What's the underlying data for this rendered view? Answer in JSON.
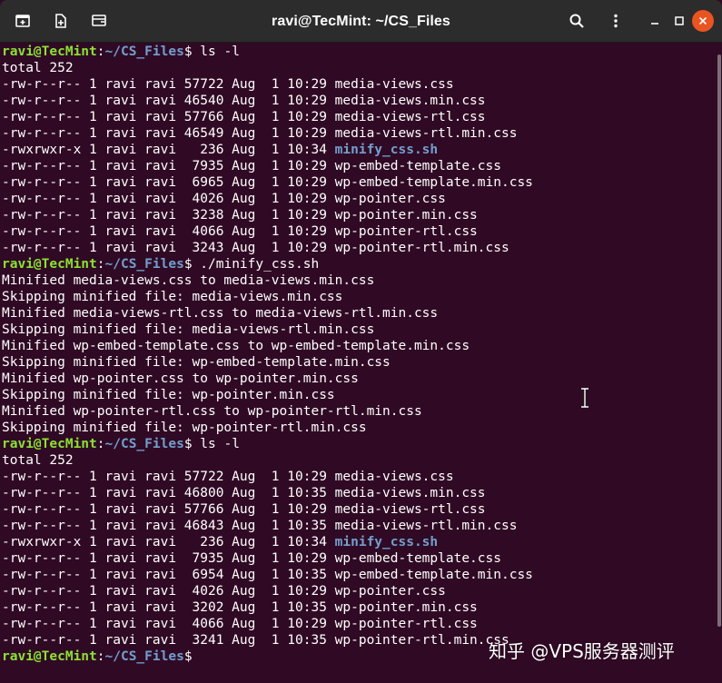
{
  "window": {
    "title": "ravi@TecMint: ~/CS_Files"
  },
  "icons": {
    "new_tab": "new-tab-icon",
    "new_window": "new-window-icon",
    "split": "split-terminal-icon",
    "search": "search-icon",
    "menu": "kebab-menu-icon",
    "minimize": "minimize-icon",
    "maximize": "maximize-icon",
    "close": "close-icon"
  },
  "colors": {
    "background": "#300a24",
    "prompt_user": "#8ae234",
    "prompt_path": "#729fcf",
    "executable": "#729fcf",
    "close_button": "#e95420",
    "titlebar": "#2c2c2c"
  },
  "prompt": {
    "user_host": "ravi@TecMint",
    "separator": ":",
    "path": "~/CS_Files",
    "symbol": "$"
  },
  "watermark": "知乎 @VPS服务器测评",
  "lines": [
    {
      "kind": "prompt",
      "cmd": " ls -l"
    },
    {
      "kind": "text",
      "text": "total 252"
    },
    {
      "kind": "ls",
      "perm": "-rw-r--r-- 1 ravi ravi 57722 Aug  1 10:29 ",
      "file": "media-views.css",
      "exec": false
    },
    {
      "kind": "ls",
      "perm": "-rw-r--r-- 1 ravi ravi 46540 Aug  1 10:29 ",
      "file": "media-views.min.css",
      "exec": false
    },
    {
      "kind": "ls",
      "perm": "-rw-r--r-- 1 ravi ravi 57766 Aug  1 10:29 ",
      "file": "media-views-rtl.css",
      "exec": false
    },
    {
      "kind": "ls",
      "perm": "-rw-r--r-- 1 ravi ravi 46549 Aug  1 10:29 ",
      "file": "media-views-rtl.min.css",
      "exec": false
    },
    {
      "kind": "ls",
      "perm": "-rwxrwxr-x 1 ravi ravi   236 Aug  1 10:34 ",
      "file": "minify_css.sh",
      "exec": true
    },
    {
      "kind": "ls",
      "perm": "-rw-r--r-- 1 ravi ravi  7935 Aug  1 10:29 ",
      "file": "wp-embed-template.css",
      "exec": false
    },
    {
      "kind": "ls",
      "perm": "-rw-r--r-- 1 ravi ravi  6965 Aug  1 10:29 ",
      "file": "wp-embed-template.min.css",
      "exec": false
    },
    {
      "kind": "ls",
      "perm": "-rw-r--r-- 1 ravi ravi  4026 Aug  1 10:29 ",
      "file": "wp-pointer.css",
      "exec": false
    },
    {
      "kind": "ls",
      "perm": "-rw-r--r-- 1 ravi ravi  3238 Aug  1 10:29 ",
      "file": "wp-pointer.min.css",
      "exec": false
    },
    {
      "kind": "ls",
      "perm": "-rw-r--r-- 1 ravi ravi  4066 Aug  1 10:29 ",
      "file": "wp-pointer-rtl.css",
      "exec": false
    },
    {
      "kind": "ls",
      "perm": "-rw-r--r-- 1 ravi ravi  3243 Aug  1 10:29 ",
      "file": "wp-pointer-rtl.min.css",
      "exec": false
    },
    {
      "kind": "prompt",
      "cmd": " ./minify_css.sh"
    },
    {
      "kind": "text",
      "text": "Minified media-views.css to media-views.min.css"
    },
    {
      "kind": "text",
      "text": "Skipping minified file: media-views.min.css"
    },
    {
      "kind": "text",
      "text": "Minified media-views-rtl.css to media-views-rtl.min.css"
    },
    {
      "kind": "text",
      "text": "Skipping minified file: media-views-rtl.min.css"
    },
    {
      "kind": "text",
      "text": "Minified wp-embed-template.css to wp-embed-template.min.css"
    },
    {
      "kind": "text",
      "text": "Skipping minified file: wp-embed-template.min.css"
    },
    {
      "kind": "text",
      "text": "Minified wp-pointer.css to wp-pointer.min.css"
    },
    {
      "kind": "text",
      "text": "Skipping minified file: wp-pointer.min.css"
    },
    {
      "kind": "text",
      "text": "Minified wp-pointer-rtl.css to wp-pointer-rtl.min.css"
    },
    {
      "kind": "text",
      "text": "Skipping minified file: wp-pointer-rtl.min.css"
    },
    {
      "kind": "prompt",
      "cmd": " ls -l"
    },
    {
      "kind": "text",
      "text": "total 252"
    },
    {
      "kind": "ls",
      "perm": "-rw-r--r-- 1 ravi ravi 57722 Aug  1 10:29 ",
      "file": "media-views.css",
      "exec": false
    },
    {
      "kind": "ls",
      "perm": "-rw-r--r-- 1 ravi ravi 46800 Aug  1 10:35 ",
      "file": "media-views.min.css",
      "exec": false
    },
    {
      "kind": "ls",
      "perm": "-rw-r--r-- 1 ravi ravi 57766 Aug  1 10:29 ",
      "file": "media-views-rtl.css",
      "exec": false
    },
    {
      "kind": "ls",
      "perm": "-rw-r--r-- 1 ravi ravi 46843 Aug  1 10:35 ",
      "file": "media-views-rtl.min.css",
      "exec": false
    },
    {
      "kind": "ls",
      "perm": "-rwxrwxr-x 1 ravi ravi   236 Aug  1 10:34 ",
      "file": "minify_css.sh",
      "exec": true
    },
    {
      "kind": "ls",
      "perm": "-rw-r--r-- 1 ravi ravi  7935 Aug  1 10:29 ",
      "file": "wp-embed-template.css",
      "exec": false
    },
    {
      "kind": "ls",
      "perm": "-rw-r--r-- 1 ravi ravi  6954 Aug  1 10:35 ",
      "file": "wp-embed-template.min.css",
      "exec": false
    },
    {
      "kind": "ls",
      "perm": "-rw-r--r-- 1 ravi ravi  4026 Aug  1 10:29 ",
      "file": "wp-pointer.css",
      "exec": false
    },
    {
      "kind": "ls",
      "perm": "-rw-r--r-- 1 ravi ravi  3202 Aug  1 10:35 ",
      "file": "wp-pointer.min.css",
      "exec": false
    },
    {
      "kind": "ls",
      "perm": "-rw-r--r-- 1 ravi ravi  4066 Aug  1 10:29 ",
      "file": "wp-pointer-rtl.css",
      "exec": false
    },
    {
      "kind": "ls",
      "perm": "-rw-r--r-- 1 ravi ravi  3241 Aug  1 10:35 ",
      "file": "wp-pointer-rtl.min.css",
      "exec": false
    },
    {
      "kind": "prompt",
      "cmd": ""
    }
  ]
}
